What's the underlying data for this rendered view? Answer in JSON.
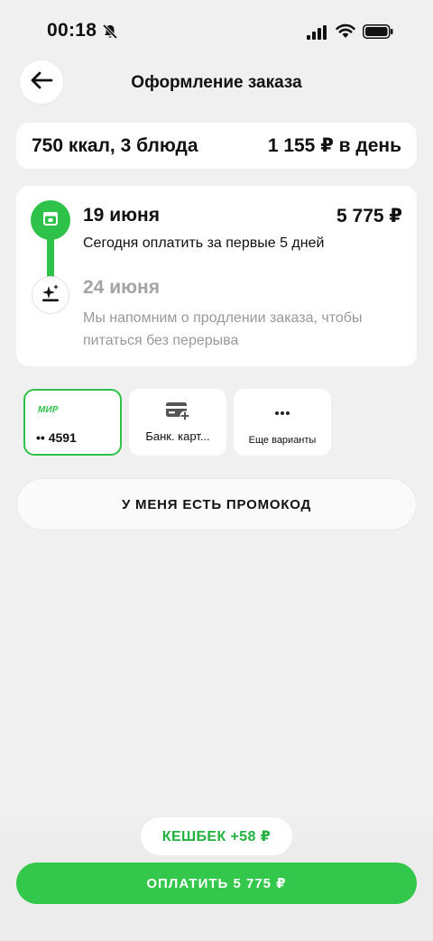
{
  "status_bar": {
    "time": "00:18"
  },
  "header": {
    "title": "Оформление заказа"
  },
  "summary": {
    "left": "750 ккал, 3 блюда",
    "right": "1 155 ₽ в день"
  },
  "schedule": {
    "step1": {
      "date": "19 июня",
      "amount": "5 775 ₽",
      "description": "Сегодня оплатить за первые 5 дней"
    },
    "step2": {
      "date": "24 июня",
      "description": "Мы напомним о продлении заказа, чтобы питаться без перерыва"
    }
  },
  "payment_methods": {
    "mir": {
      "logo": "МИР",
      "number": "•• 4591",
      "selected": true
    },
    "bank": {
      "label": "Банк. карт..."
    },
    "more": {
      "label": "Еще варианты"
    }
  },
  "promo": {
    "label": "У МЕНЯ ЕСТЬ ПРОМОКОД"
  },
  "cashback": {
    "label": "КЕШБЕК +58 ₽"
  },
  "pay": {
    "label": "ОПЛАТИТЬ 5 775 ₽"
  },
  "colors": {
    "accent": "#33c74b",
    "background": "#f0f0f0",
    "muted": "#999999"
  },
  "icons": [
    "bell-off-icon",
    "signal-icon",
    "wifi-icon",
    "battery-icon",
    "arrow-left-icon",
    "calendar-icon",
    "sparkle-icon",
    "card-add-icon",
    "more-dots-icon"
  ]
}
